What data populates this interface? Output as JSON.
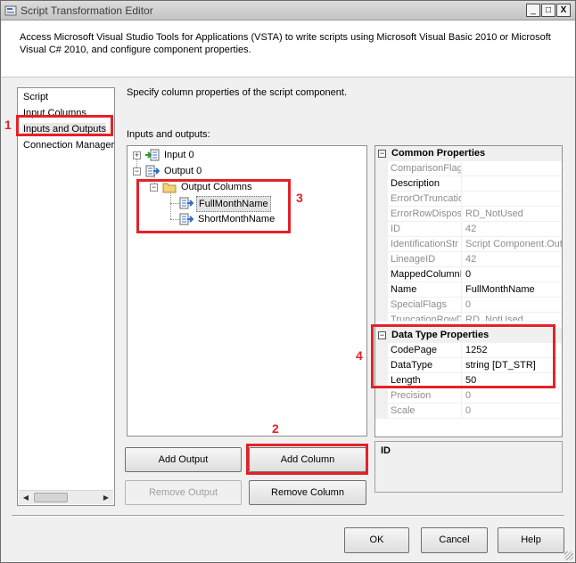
{
  "window": {
    "title": "Script Transformation Editor",
    "controls": {
      "minimize": "_",
      "maximize": "□",
      "close": "X"
    }
  },
  "header": {
    "description": "Access Microsoft Visual Studio Tools for Applications (VSTA) to write scripts using Microsoft Visual Basic 2010 or Microsoft Visual C# 2010, and configure component properties."
  },
  "nav": {
    "items": [
      "Script",
      "Input Columns",
      "Inputs and Outputs",
      "Connection Managers"
    ],
    "selected_index": 2
  },
  "main": {
    "description": "Specify column properties of the script component.",
    "io_label": "Inputs and outputs:",
    "tree": {
      "input": "Input 0",
      "output": "Output 0",
      "output_columns": "Output Columns",
      "columns": [
        "FullMonthName",
        "ShortMonthName"
      ],
      "selected_column": "FullMonthName"
    }
  },
  "properties": {
    "common_title": "Common Properties",
    "common": [
      {
        "name": "ComparisonFlags",
        "value": "",
        "readonly": true
      },
      {
        "name": "Description",
        "value": "",
        "readonly": false
      },
      {
        "name": "ErrorOrTruncatio",
        "value": "",
        "readonly": true
      },
      {
        "name": "ErrorRowDisposi",
        "value": "RD_NotUsed",
        "readonly": true
      },
      {
        "name": "ID",
        "value": "42",
        "readonly": true
      },
      {
        "name": "IdentificationStr",
        "value": "Script Component.Outp",
        "readonly": true
      },
      {
        "name": "LineageID",
        "value": "42",
        "readonly": true
      },
      {
        "name": "MappedColumnI",
        "value": "0",
        "readonly": false
      },
      {
        "name": "Name",
        "value": "FullMonthName",
        "readonly": false
      },
      {
        "name": "SpecialFlags",
        "value": "0",
        "readonly": true
      },
      {
        "name": "TruncationRowD",
        "value": "RD_NotUsed",
        "readonly": true
      }
    ],
    "datatype_title": "Data Type Properties",
    "datatype": [
      {
        "name": "CodePage",
        "value": "1252",
        "readonly": false
      },
      {
        "name": "DataType",
        "value": "string [DT_STR]",
        "readonly": false
      },
      {
        "name": "Length",
        "value": "50",
        "readonly": false
      },
      {
        "name": "Precision",
        "value": "0",
        "readonly": true
      },
      {
        "name": "Scale",
        "value": "0",
        "readonly": true
      }
    ],
    "expander_symbol": "−",
    "description_title": "ID"
  },
  "buttons": {
    "add_output": "Add Output",
    "add_column": "Add Column",
    "remove_output": "Remove Output",
    "remove_column": "Remove Column",
    "ok": "OK",
    "cancel": "Cancel",
    "help": "Help"
  },
  "annotations": [
    "1",
    "2",
    "3",
    "4"
  ],
  "colors": {
    "annotation_red": "#e32228",
    "selection_gray": "#e3e3e3"
  }
}
